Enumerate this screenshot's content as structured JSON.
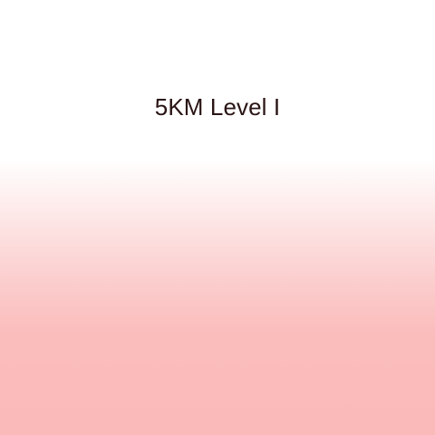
{
  "workout": {
    "title": "5KM Level I"
  },
  "colors": {
    "background_top": "#ffffff",
    "background_bottom": "#fbbaba",
    "title_text": "#2a1414"
  }
}
